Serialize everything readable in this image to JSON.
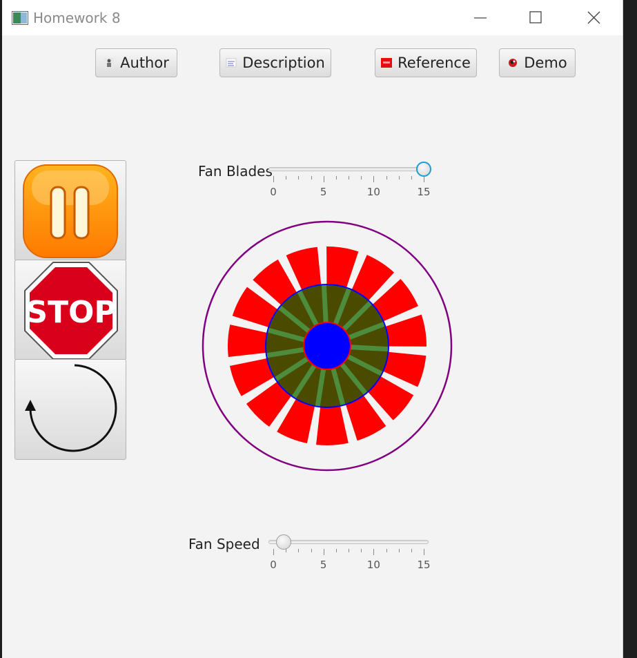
{
  "window": {
    "title": "Homework 8"
  },
  "toolbar": {
    "author_label": "Author",
    "description_label": "Description",
    "reference_label": "Reference",
    "demo_label": "Demo"
  },
  "controls": {
    "blades_label": "Fan Blades",
    "speed_label": "Fan Speed",
    "blades_value": 15,
    "speed_value": 1,
    "slider_min": 0,
    "slider_max": 15,
    "tick_labels": [
      "0",
      "5",
      "10",
      "15"
    ]
  },
  "fan": {
    "blade_count": 15,
    "colors": {
      "outer_ring": "#800080",
      "blade": "#ff0000",
      "hub": "#4b4b00",
      "hub_border": "#0000ff",
      "center": "#0000ff",
      "center_border": "#ff0000",
      "spoke": "#4c8c3c"
    }
  },
  "side_buttons": {
    "pause": "pause-icon",
    "stop": "stop-sign-icon",
    "reverse": "reverse-arrow-icon",
    "stop_text": "STOP"
  }
}
